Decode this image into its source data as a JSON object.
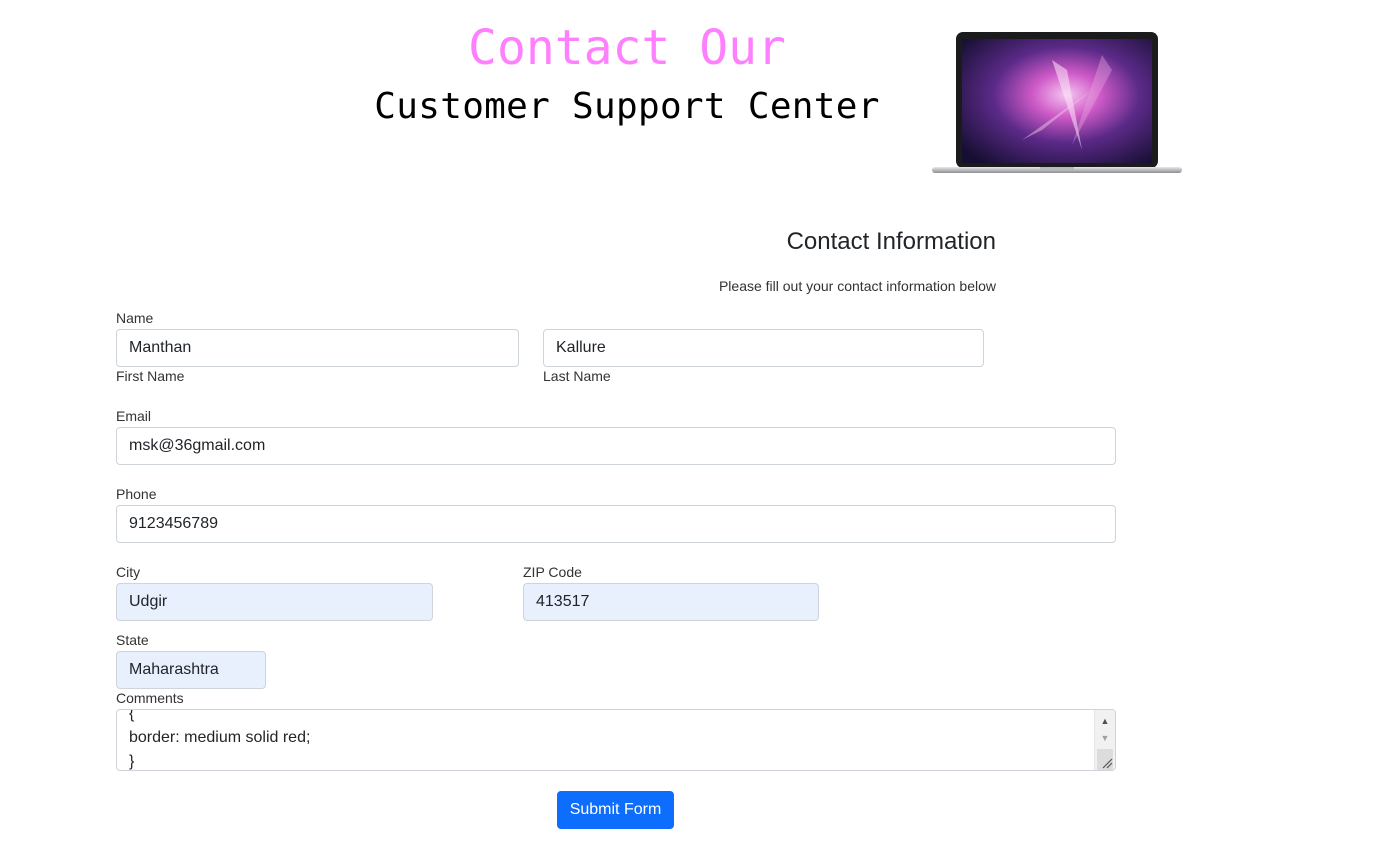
{
  "header": {
    "title_line1": "Contact Our",
    "title_line2": "Customer Support Center",
    "title_line1_color": "#ff80ff",
    "image": "laptop-image"
  },
  "form": {
    "heading": "Contact Information",
    "subheading": "Please fill out your contact information below",
    "name": {
      "label": "Name",
      "first_value": "Manthan",
      "first_caption": "First Name",
      "last_value": "Kallure",
      "last_caption": "Last Name"
    },
    "email": {
      "label": "Email",
      "value": "msk@36gmail.com"
    },
    "phone": {
      "label": "Phone",
      "value": "9123456789"
    },
    "city": {
      "label": "City",
      "value": "Udgir"
    },
    "zip": {
      "label": "ZIP Code",
      "value": "413517"
    },
    "state": {
      "label": "State",
      "value": "Maharashtra"
    },
    "comments": {
      "label": "Comments",
      "value": "{\nborder: medium solid red;\n}"
    },
    "submit_label": "Submit Form",
    "submit_color": "#0d6efd",
    "autofill_color": "#e8f0fe"
  }
}
